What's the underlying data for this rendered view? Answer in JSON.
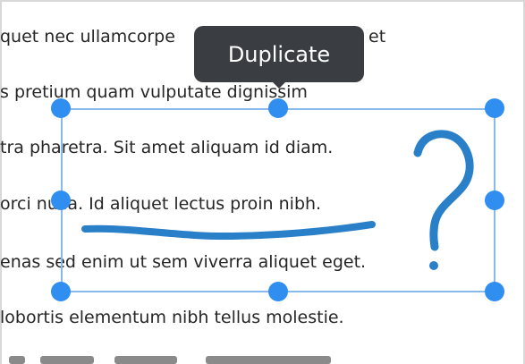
{
  "document": {
    "lines": [
      "quet nec ullamcorpe",
      "s pretium quam vulputate dignissim",
      "tra pharetra. Sit amet aliquam id diam.",
      "orci nulla. Id aliquet lectus proin nibh.",
      "enas sed enim ut sem viverra aliquet eget.",
      "lobortis elementum nibh tellus molestie."
    ],
    "line1_tail": "et"
  },
  "tooltip": {
    "label": "Duplicate"
  },
  "colors": {
    "ink": "#2a7fc9",
    "selection_border": "#88b9ec",
    "handle": "#2f8ef0",
    "tooltip_bg": "#3a3e43",
    "text": "#262626"
  }
}
